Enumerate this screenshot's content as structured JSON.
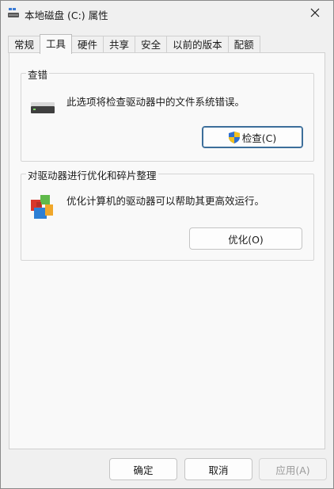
{
  "window": {
    "title": "本地磁盘 (C:) 属性"
  },
  "tabs": [
    {
      "label": "常规",
      "active": false
    },
    {
      "label": "工具",
      "active": true
    },
    {
      "label": "硬件",
      "active": false
    },
    {
      "label": "共享",
      "active": false
    },
    {
      "label": "安全",
      "active": false
    },
    {
      "label": "以前的版本",
      "active": false
    },
    {
      "label": "配额",
      "active": false
    }
  ],
  "error_check": {
    "title": "查错",
    "description": "此选项将检查驱动器中的文件系统错误。",
    "button_label": "检查(C)",
    "icon": "drive-icon"
  },
  "optimize": {
    "title": "对驱动器进行优化和碎片整理",
    "description": "优化计算机的驱动器可以帮助其更高效运行。",
    "button_label": "优化(O)",
    "icon": "defrag-icon"
  },
  "footer": {
    "ok_label": "确定",
    "cancel_label": "取消",
    "apply_label": "应用(A)"
  },
  "colors": {
    "accent": "#3c6e9a",
    "window_bg": "#f0f0f0",
    "panel_bg": "#f9f9f9"
  }
}
